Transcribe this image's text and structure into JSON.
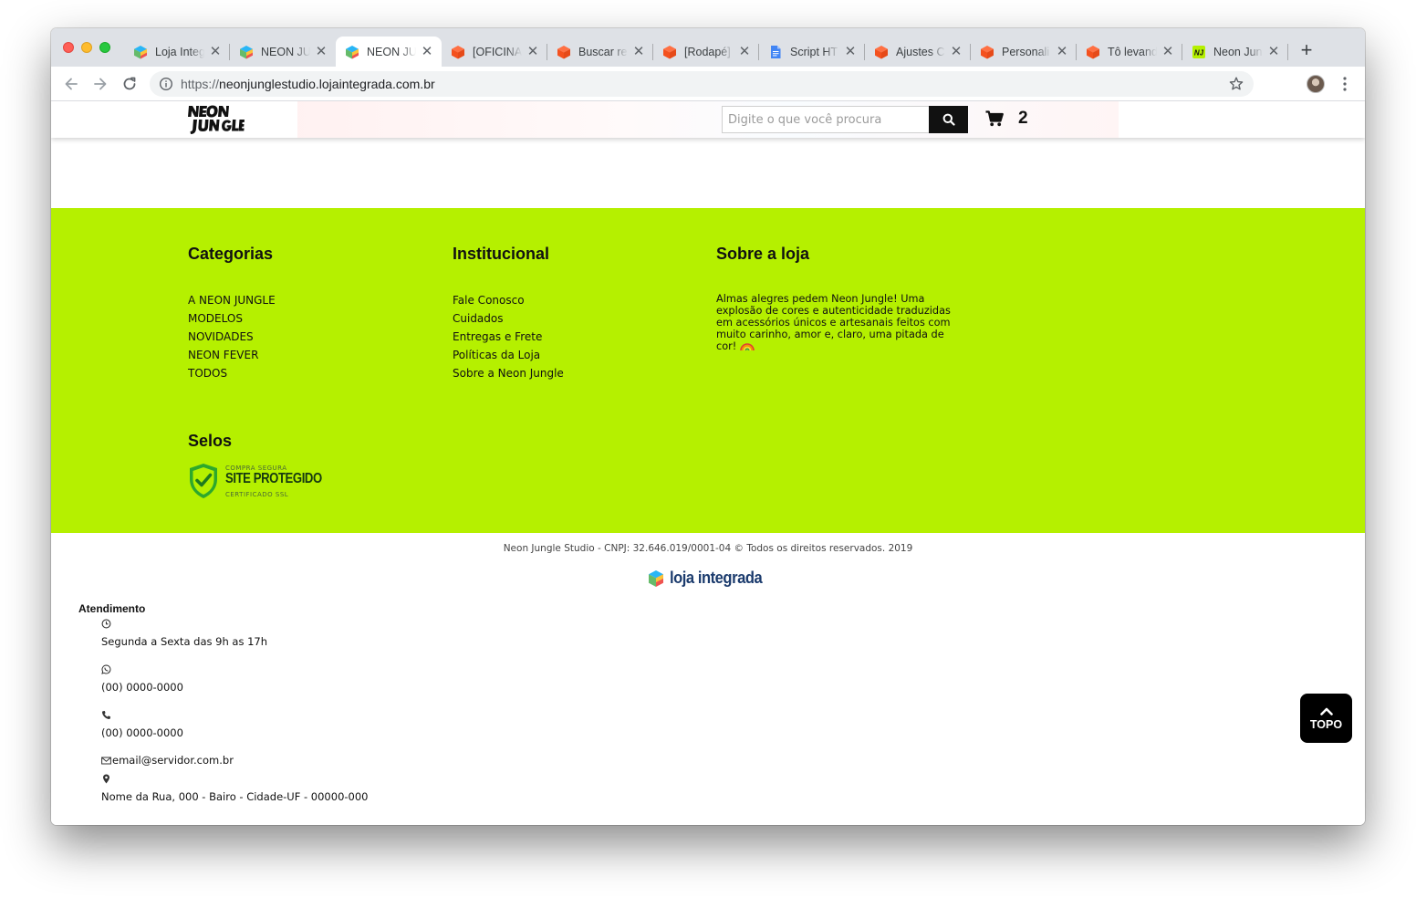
{
  "browser": {
    "tabs": [
      {
        "title": "Loja Integrada",
        "favicon": "loja-integrada-cube-icon",
        "active": false
      },
      {
        "title": "NEON JUNGLE",
        "favicon": "loja-integrada-cube-icon",
        "active": false
      },
      {
        "title": "NEON JUNGLE",
        "favicon": "loja-integrada-cube-icon",
        "active": true
      },
      {
        "title": "[OFICINA",
        "favicon": "orange-box-icon",
        "active": false
      },
      {
        "title": "Buscar re",
        "favicon": "orange-box-icon",
        "active": false
      },
      {
        "title": "[Rodapé]",
        "favicon": "orange-box-icon",
        "active": false
      },
      {
        "title": "Script HT",
        "favicon": "google-docs-icon",
        "active": false
      },
      {
        "title": "Ajustes C",
        "favicon": "orange-box-icon",
        "active": false
      },
      {
        "title": "Personali",
        "favicon": "orange-box-icon",
        "active": false
      },
      {
        "title": "Tô levand",
        "favicon": "orange-box-icon",
        "active": false
      },
      {
        "title": "Neon Jun",
        "favicon": "neon-jungle-nj-icon",
        "active": false
      }
    ],
    "close_glyph": "✕",
    "new_tab_glyph": "+",
    "url_scheme": "https://",
    "url_host": "neonjunglestudio.lojaintegrada.com.br"
  },
  "header": {
    "search_placeholder": "Digite o que você procura",
    "cart_count": "2"
  },
  "footer": {
    "categorias": {
      "title": "Categorias",
      "items": [
        "A NEON JUNGLE",
        "MODELOS",
        "NOVIDADES",
        "NEON FEVER",
        "TODOS"
      ]
    },
    "institucional": {
      "title": "Institucional",
      "items": [
        "Fale Conosco",
        "Cuidados",
        "Entregas e Frete",
        "Políticas da Loja",
        "Sobre a Neon Jungle"
      ]
    },
    "sobre": {
      "title": "Sobre a loja",
      "text": "Almas alegres pedem Neon Jungle! Uma explosão de cores e autenticidade traduzidas em acessórios únicos e artesanais feitos com muito carinho, amor e, claro, uma pitada de cor!"
    },
    "selos": {
      "title": "Selos",
      "seal_top": "COMPRA SEGURA",
      "seal_main": "SITE PROTEGIDO",
      "seal_bottom": "CERTIFICADO SSL"
    },
    "copyright": "Neon Jungle Studio - CNPJ: 32.646.019/0001-04 © Todos os direitos reservados. 2019",
    "platform_logo_text": "loja integrada"
  },
  "atendimento": {
    "title": "Atendimento",
    "hours": "Segunda a Sexta das 9h as 17h",
    "whatsapp": "(00) 0000-0000",
    "phone": "(00) 0000-0000",
    "email": "email@servidor.com.br",
    "address": "Nome da Rua, 000 - Bairo - Cidade-UF - 00000-000"
  },
  "back_to_top": "TOPO",
  "colors": {
    "footer_green": "#b5f000",
    "seal_green": "#2da82c",
    "platform_blue": "#1b3b6d"
  }
}
